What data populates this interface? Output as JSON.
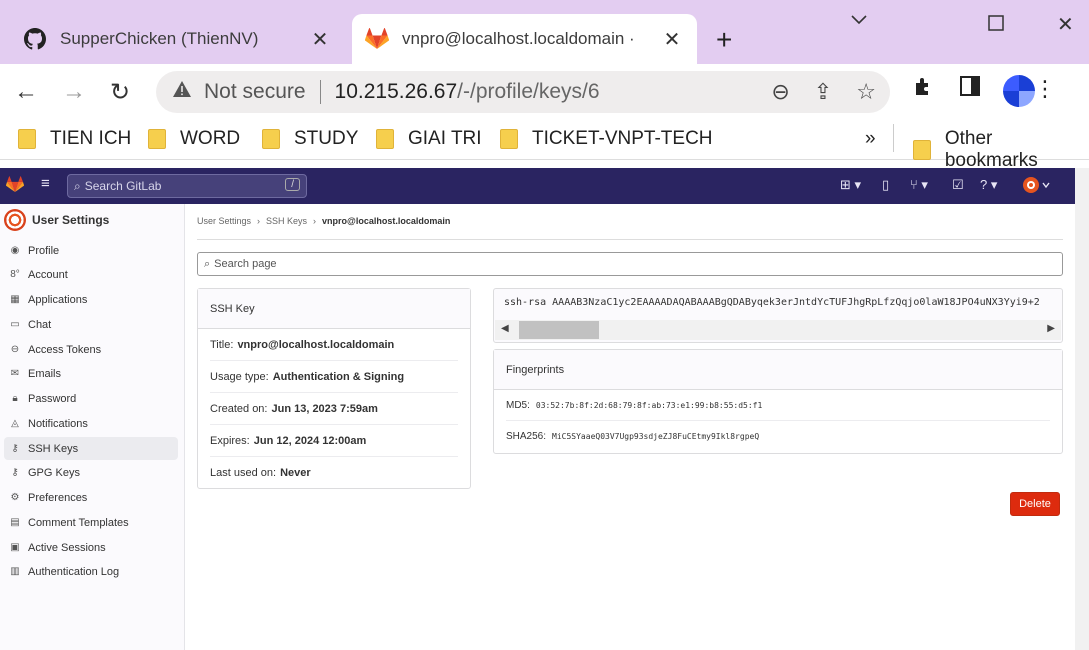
{
  "browser": {
    "tabs": [
      {
        "title": "SupperChicken (ThienNV)",
        "icon": "github-icon"
      },
      {
        "title": "vnpro@localhost.localdomain ·",
        "icon": "gitlab-icon"
      }
    ],
    "omnibox": {
      "security": "Not secure",
      "host": "10.215.26.67",
      "path": "/-/profile/keys/6"
    },
    "bookmarks": [
      "TIEN ICH",
      "WORD",
      "STUDY",
      "GIAI TRI",
      "TICKET-VNPT-TECH"
    ],
    "overflow": "»",
    "other_bookmarks": "Other bookmarks"
  },
  "gitlab": {
    "search_placeholder": "Search GitLab",
    "search_shortcut": "/"
  },
  "sidebar": {
    "title": "User Settings",
    "items": [
      {
        "label": "Profile",
        "icon": "profile-icon"
      },
      {
        "label": "Account",
        "icon": "account-icon"
      },
      {
        "label": "Applications",
        "icon": "applications-icon"
      },
      {
        "label": "Chat",
        "icon": "chat-icon"
      },
      {
        "label": "Access Tokens",
        "icon": "token-icon"
      },
      {
        "label": "Emails",
        "icon": "email-icon"
      },
      {
        "label": "Password",
        "icon": "password-icon"
      },
      {
        "label": "Notifications",
        "icon": "bell-icon"
      },
      {
        "label": "SSH Keys",
        "icon": "key-icon"
      },
      {
        "label": "GPG Keys",
        "icon": "key-icon"
      },
      {
        "label": "Preferences",
        "icon": "preferences-icon"
      },
      {
        "label": "Comment Templates",
        "icon": "comment-icon"
      },
      {
        "label": "Active Sessions",
        "icon": "monitor-icon"
      },
      {
        "label": "Authentication Log",
        "icon": "log-icon"
      }
    ]
  },
  "breadcrumb": [
    "User Settings",
    "SSH Keys",
    "vnpro@localhost.localdomain"
  ],
  "search_page_placeholder": "Search page",
  "ssh_key": {
    "heading": "SSH Key",
    "title_label": "Title:",
    "title_value": "vnpro@localhost.localdomain",
    "usage_label": "Usage type:",
    "usage_value": "Authentication & Signing",
    "created_label": "Created on:",
    "created_value": "Jun 13, 2023 7:59am",
    "expires_label": "Expires:",
    "expires_value": "Jun 12, 2024 12:00am",
    "last_used_label": "Last used on:",
    "last_used_value": "Never",
    "key_text": "ssh-rsa AAAAB3NzaC1yc2EAAAADAQABAAABgQDAByqek3erJntdYcTUFJhgRpLfzQqjo0laW18JPO4uNX3Yyi9+2"
  },
  "fingerprints": {
    "heading": "Fingerprints",
    "md5_label": "MD5:",
    "md5_value": "03:52:7b:8f:2d:68:79:8f:ab:73:e1:99:b8:55:d5:f1",
    "sha_label": "SHA256:",
    "sha_value": "MiC5SYaaeQ03V7Ugp93sdjeZJ8FuCEtmy9Ikl8rgpeQ"
  },
  "delete_label": "Delete"
}
